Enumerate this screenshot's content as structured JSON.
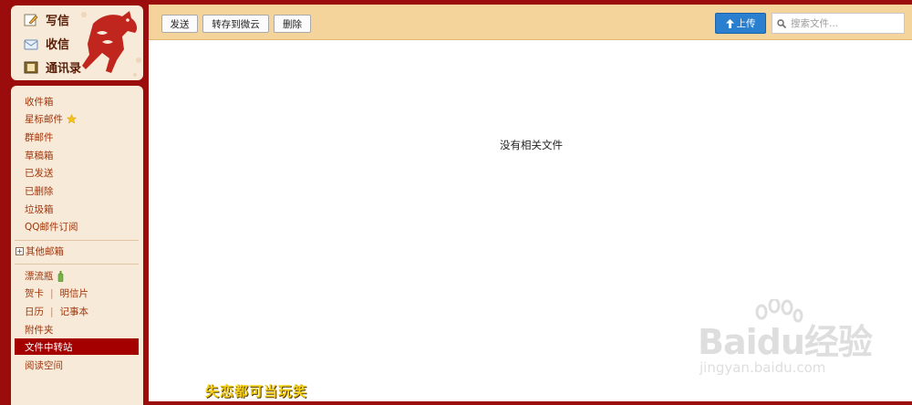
{
  "quick_actions": {
    "compose": "写信",
    "inbox": "收信",
    "contacts": "通讯录"
  },
  "folders": {
    "inbox": "收件箱",
    "starred": "星标邮件",
    "group": "群邮件",
    "drafts": "草稿箱",
    "sent": "已发送",
    "deleted": "已删除",
    "spam": "垃圾箱",
    "subscriptions": "QQ邮件订阅",
    "other_mailboxes": "其他邮箱",
    "drift_bottle": "漂流瓶",
    "greeting_card": "贺卡",
    "postcard": "明信片",
    "calendar": "日历",
    "notepad": "记事本",
    "attachments": "附件夹",
    "file_transfer": "文件中转站",
    "reading_space": "阅读空间",
    "sep": "|"
  },
  "toolbar": {
    "send": "发送",
    "save_to_cloud": "转存到微云",
    "delete": "删除",
    "upload": "上传",
    "search_placeholder": "搜索文件..."
  },
  "main": {
    "empty_message": "没有相关文件"
  },
  "promo": {
    "text": "失恋都可当玩笑"
  },
  "watermark": {
    "logo_text": "Baidu经验",
    "url": "jingyan.baidu.com"
  },
  "colors": {
    "frame": "#9b0c0c",
    "panel": "#f7ead8",
    "toolbar": "#f4d49a",
    "selected": "#a40000",
    "upload": "#2a7fcf"
  }
}
